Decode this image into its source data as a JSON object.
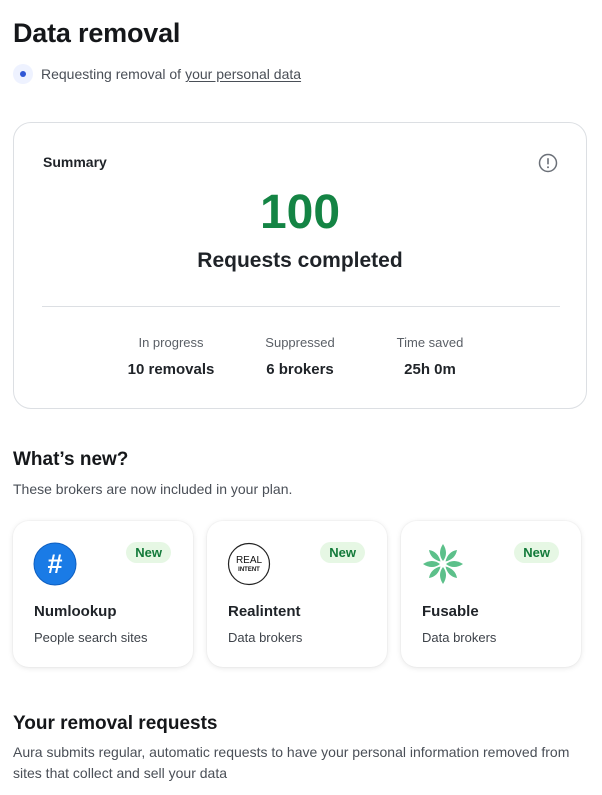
{
  "header": {
    "title": "Data removal",
    "request_prefix": "Requesting removal of",
    "request_link": "your personal data"
  },
  "summary": {
    "label": "Summary",
    "completed_count": "100",
    "completed_caption": "Requests completed",
    "stats": [
      {
        "label": "In progress",
        "value": "10 removals"
      },
      {
        "label": "Suppressed",
        "value": "6 brokers"
      },
      {
        "label": "Time saved",
        "value": "25h 0m"
      }
    ]
  },
  "whats_new": {
    "title": "What’s new?",
    "subtitle": "These brokers are now included in your plan.",
    "brokers": [
      {
        "name": "Numlookup",
        "category": "People search sites",
        "badge": "New",
        "logo": "hash-icon"
      },
      {
        "name": "Realintent",
        "category": "Data brokers",
        "badge": "New",
        "logo": "realintent-logo",
        "logo_text_line1": "REAL",
        "logo_text_line2": "INTENT"
      },
      {
        "name": "Fusable",
        "category": "Data brokers",
        "badge": "New",
        "logo": "fusable-logo"
      }
    ]
  },
  "removal_requests": {
    "title": "Your removal requests",
    "description": "Aura submits regular, automatic requests to have your personal information removed from sites that collect and sell your data"
  },
  "colors": {
    "accent_green": "#148444",
    "badge_bg": "#e6f7e4",
    "link_blue_dot": "#3057d5",
    "numlookup_blue": "#1a7be6",
    "fusable_green": "#5cc08a"
  }
}
